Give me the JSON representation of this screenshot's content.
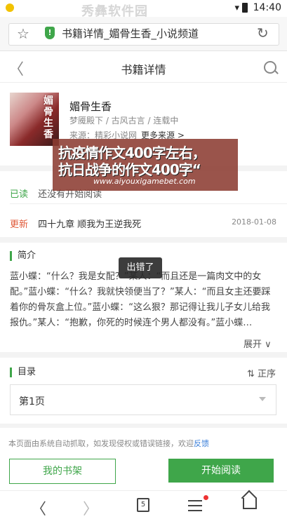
{
  "status_bar": {
    "time": "14:40",
    "watermark": "秀彝软件园"
  },
  "address_bar": {
    "page_title": "书籍详情_媚骨生香_小说频道"
  },
  "header": {
    "title": "书籍详情"
  },
  "book": {
    "name": "媚骨生香",
    "meta": "梦魇殿下 / 古风古言 / 连载中",
    "source_prefix": "来源：精彩小说网",
    "more_sources": "更多来源 >",
    "cover_text": "媚骨生香"
  },
  "ad_overlay": {
    "line1": "抗疫情作文400字左右，",
    "line2": "抗日战争的作文400字“",
    "url": "www.aiyouxigamebet.com"
  },
  "reading": {
    "read_label": "已读",
    "read_value": "还没有开始阅读",
    "update_label": "更新",
    "update_value": "四十九章 顺我为王逆我死",
    "update_date": "2018-01-08"
  },
  "intro": {
    "heading": "简介",
    "text": "蓝小蝶：“什么？我是女配？”某人：“而且还是一篇肉文中的女配。”蓝小蝶：“什么？我就快领便当了？”某人：“而且女主还要踩着你的骨灰盒上位。”蓝小蝶：“这么狠？那记得让我儿子女儿给我报仇。”某人：“抱歉，你死的时候连个男人都没有。”蓝小蝶…",
    "expand_label": "展开 ∨",
    "toast": "出错了"
  },
  "catalog": {
    "heading": "目录",
    "sort_label": "⇅ 正序",
    "page_select": "第1页"
  },
  "footer": {
    "notice": "本页面由系统自动抓取，如发现侵权或错误链接，欢迎",
    "feedback": "反馈"
  },
  "actions": {
    "shelf": "我的书架",
    "read": "开始阅读"
  },
  "bottom_nav": {
    "back": "〈",
    "forward": "〉",
    "tab_count": "5"
  },
  "colors": {
    "accent": "#3fa64a",
    "update": "#e05a3a",
    "link": "#3b7fd9"
  }
}
